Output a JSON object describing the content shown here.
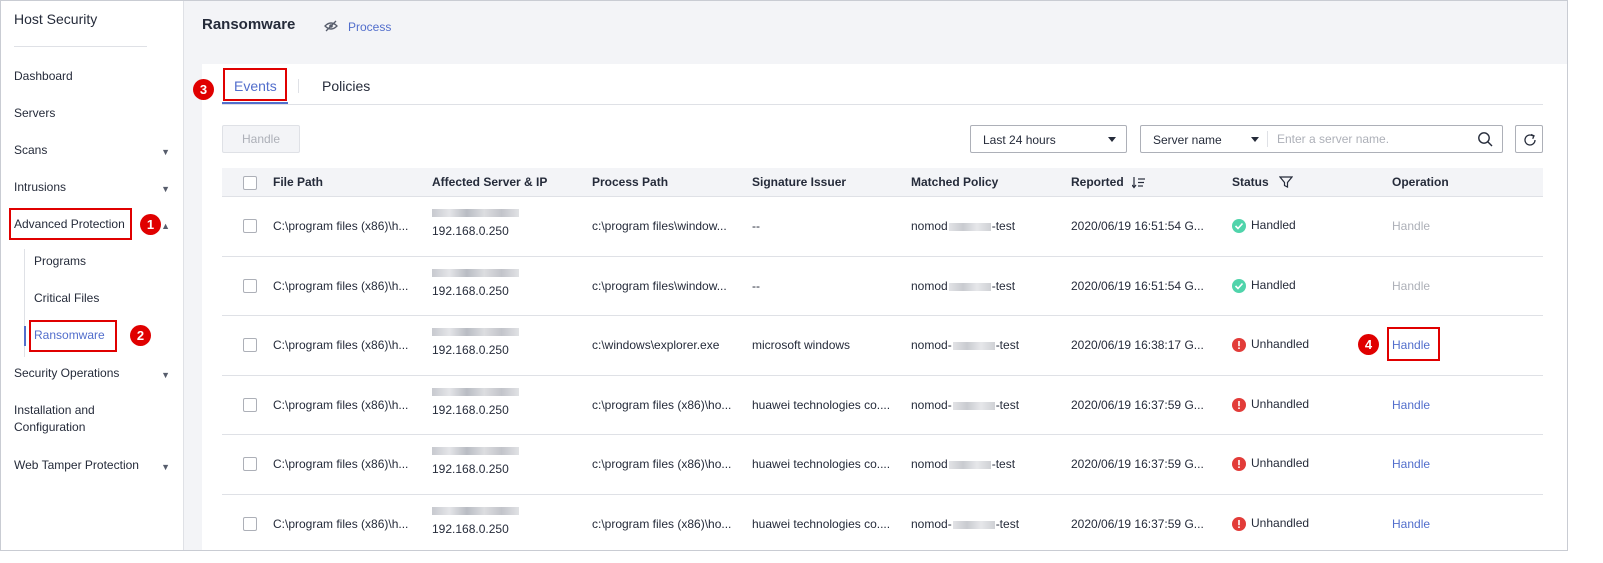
{
  "sidebar": {
    "title": "Host Security",
    "items": {
      "dashboard": "Dashboard",
      "servers": "Servers",
      "scans": "Scans",
      "intrusions": "Intrusions",
      "advanced_protection": "Advanced Protection",
      "programs": "Programs",
      "critical_files": "Critical Files",
      "ransomware": "Ransomware",
      "security_operations": "Security Operations",
      "installation_line1": "Installation and",
      "installation_line2": "Configuration",
      "web_tamper": "Web Tamper Protection"
    }
  },
  "header": {
    "title": "Ransomware",
    "process_link": "Process"
  },
  "tabs": {
    "events": "Events",
    "policies": "Policies"
  },
  "toolbar": {
    "handle_label": "Handle",
    "time_range": "Last 24 hours",
    "search_field": "Server name",
    "search_placeholder": "Enter a server name."
  },
  "annotations": {
    "a1": "1",
    "a2": "2",
    "a3": "3",
    "a4": "4"
  },
  "table": {
    "columns": {
      "file_path": "File Path",
      "affected": "Affected Server & IP",
      "process_path": "Process Path",
      "issuer": "Signature Issuer",
      "policy": "Matched Policy",
      "reported": "Reported",
      "status": "Status",
      "operation": "Operation"
    },
    "rows": [
      {
        "file_path": "C:\\program files (x86)\\h...",
        "ip": "192.168.0.250",
        "process_path": "c:\\program files\\window...",
        "issuer": "--",
        "policy_pre": "nomod",
        "policy_post": "-test",
        "reported": "2020/06/19 16:51:54 G...",
        "status": "Handled",
        "operation": "Handle"
      },
      {
        "file_path": "C:\\program files (x86)\\h...",
        "ip": "192.168.0.250",
        "process_path": "c:\\program files\\window...",
        "issuer": "--",
        "policy_pre": "nomod",
        "policy_post": "-test",
        "reported": "2020/06/19 16:51:54 G...",
        "status": "Handled",
        "operation": "Handle"
      },
      {
        "file_path": "C:\\program files (x86)\\h...",
        "ip": "192.168.0.250",
        "process_path": "c:\\windows\\explorer.exe",
        "issuer": "microsoft windows",
        "policy_pre": "nomod-",
        "policy_post": "-test",
        "reported": "2020/06/19 16:38:17 G...",
        "status": "Unhandled",
        "operation": "Handle"
      },
      {
        "file_path": "C:\\program files (x86)\\h...",
        "ip": "192.168.0.250",
        "process_path": "c:\\program files (x86)\\ho...",
        "issuer": "huawei technologies co....",
        "policy_pre": "nomod-",
        "policy_post": "-test",
        "reported": "2020/06/19 16:37:59 G...",
        "status": "Unhandled",
        "operation": "Handle"
      },
      {
        "file_path": "C:\\program files (x86)\\h...",
        "ip": "192.168.0.250",
        "process_path": "c:\\program files (x86)\\ho...",
        "issuer": "huawei technologies co....",
        "policy_pre": "nomod",
        "policy_post": "-test",
        "reported": "2020/06/19 16:37:59 G...",
        "status": "Unhandled",
        "operation": "Handle"
      },
      {
        "file_path": "C:\\program files (x86)\\h...",
        "ip": "192.168.0.250",
        "process_path": "c:\\program files (x86)\\ho...",
        "issuer": "huawei technologies co....",
        "policy_pre": "nomod-",
        "policy_post": "-test",
        "reported": "2020/06/19 16:37:59 G...",
        "status": "Unhandled",
        "operation": "Handle"
      }
    ]
  },
  "colors": {
    "accent": "#526ecc",
    "handled": "#50d4ab",
    "unhandled": "#e23c39",
    "highlight": "#e00000"
  }
}
